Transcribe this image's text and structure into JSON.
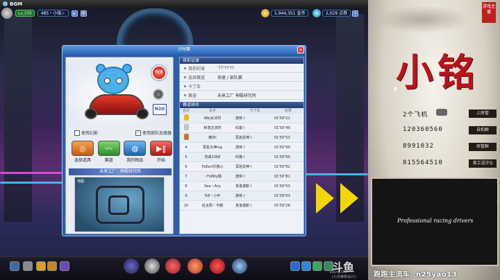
{
  "window": {
    "title": "BGM"
  },
  "player": {
    "level": "Lv.100",
    "name": "485・小铭☆"
  },
  "currency": {
    "coupons": "1,944,351 金币",
    "points": "2,029 点券"
  },
  "dialog": {
    "title": "计时赛",
    "speed_button": "快速",
    "n2o_label": "N2O",
    "checks": {
      "phantom": "使用幻影",
      "team_boost": "使用部队加速器"
    },
    "actions": [
      {
        "label": "选择道具"
      },
      {
        "label": "赛道"
      },
      {
        "label": "我的物品"
      },
      {
        "label": "开始"
      }
    ],
    "track_name": "未来工厂 · 神殿研究所",
    "map_label": "地图"
  },
  "records": {
    "header": "目前记录",
    "rows": [
      {
        "key": "目前纪录",
        "value": "'??'??'??"
      },
      {
        "key": "选择赛道",
        "value": "快速 / 部队赛"
      },
      {
        "key": "卡丁车",
        "value": ""
      },
      {
        "key": "赛道",
        "value": "未来工厂  神殿研究所"
      }
    ]
  },
  "ranking": {
    "header": "赛道排名",
    "columns": [
      "名次",
      "车手",
      "卡丁车",
      "纪录"
    ],
    "rows": [
      {
        "rank": "1",
        "name": "We|水浒月",
        "car": "游侠 I",
        "time": "01'50\"21",
        "medal": "#e8b820"
      },
      {
        "rank": "2",
        "name": "秋意正浓时",
        "car": "红旗 I",
        "time": "01'50\"40",
        "medal": "#c0c4cc"
      },
      {
        "rank": "3",
        "name": "散伙i",
        "car": "冥焰龙神 I",
        "time": "01'50\"53",
        "medal": "#c27a3a"
      },
      {
        "rank": "4",
        "name": "慧星大神ing",
        "car": "游侠 I",
        "time": "01'50\"60",
        "medal": ""
      },
      {
        "rank": "5",
        "name": "夯咸1368",
        "car": "红旗 I",
        "time": "01'50\"60",
        "medal": ""
      },
      {
        "rank": "6",
        "name": "FoEart乐慈心",
        "car": "冥焰龙神 I",
        "time": "01'50\"62",
        "medal": ""
      },
      {
        "rank": "7",
        "name": "・FoMily璐",
        "car": "游侠 I",
        "time": "01'50\"81",
        "medal": ""
      },
      {
        "rank": "8",
        "name": "Sea・Any",
        "car": "克洛诺斯 I",
        "time": "01'59\"03",
        "medal": ""
      },
      {
        "rank": "9",
        "name": "TcE・小叶",
        "car": "游侠 I",
        "time": "01'59\"03",
        "medal": ""
      },
      {
        "rank": "10",
        "name": "紅太阳・今朝",
        "car": "克洛诺斯 I",
        "time": "01'59\"28",
        "medal": ""
      }
    ]
  },
  "bottom": {
    "brand": "斗鱼",
    "brand_url": "DOUYU.COM",
    "tagline": "[七月推荐设计]"
  },
  "overlay": {
    "big_name": "小铭",
    "seal": "游戏主播",
    "lines": [
      {
        "text": "2个飞机",
        "tag": "上房管"
      },
      {
        "text": "120360560",
        "tag": "自拍群"
      },
      {
        "text": "8991032",
        "tag": "房管群"
      },
      {
        "text": "815564510",
        "tag": "美工设计Q"
      }
    ],
    "video_brand": "Professional racing drivers",
    "footer": "跑跑主流车: n25yao13"
  }
}
